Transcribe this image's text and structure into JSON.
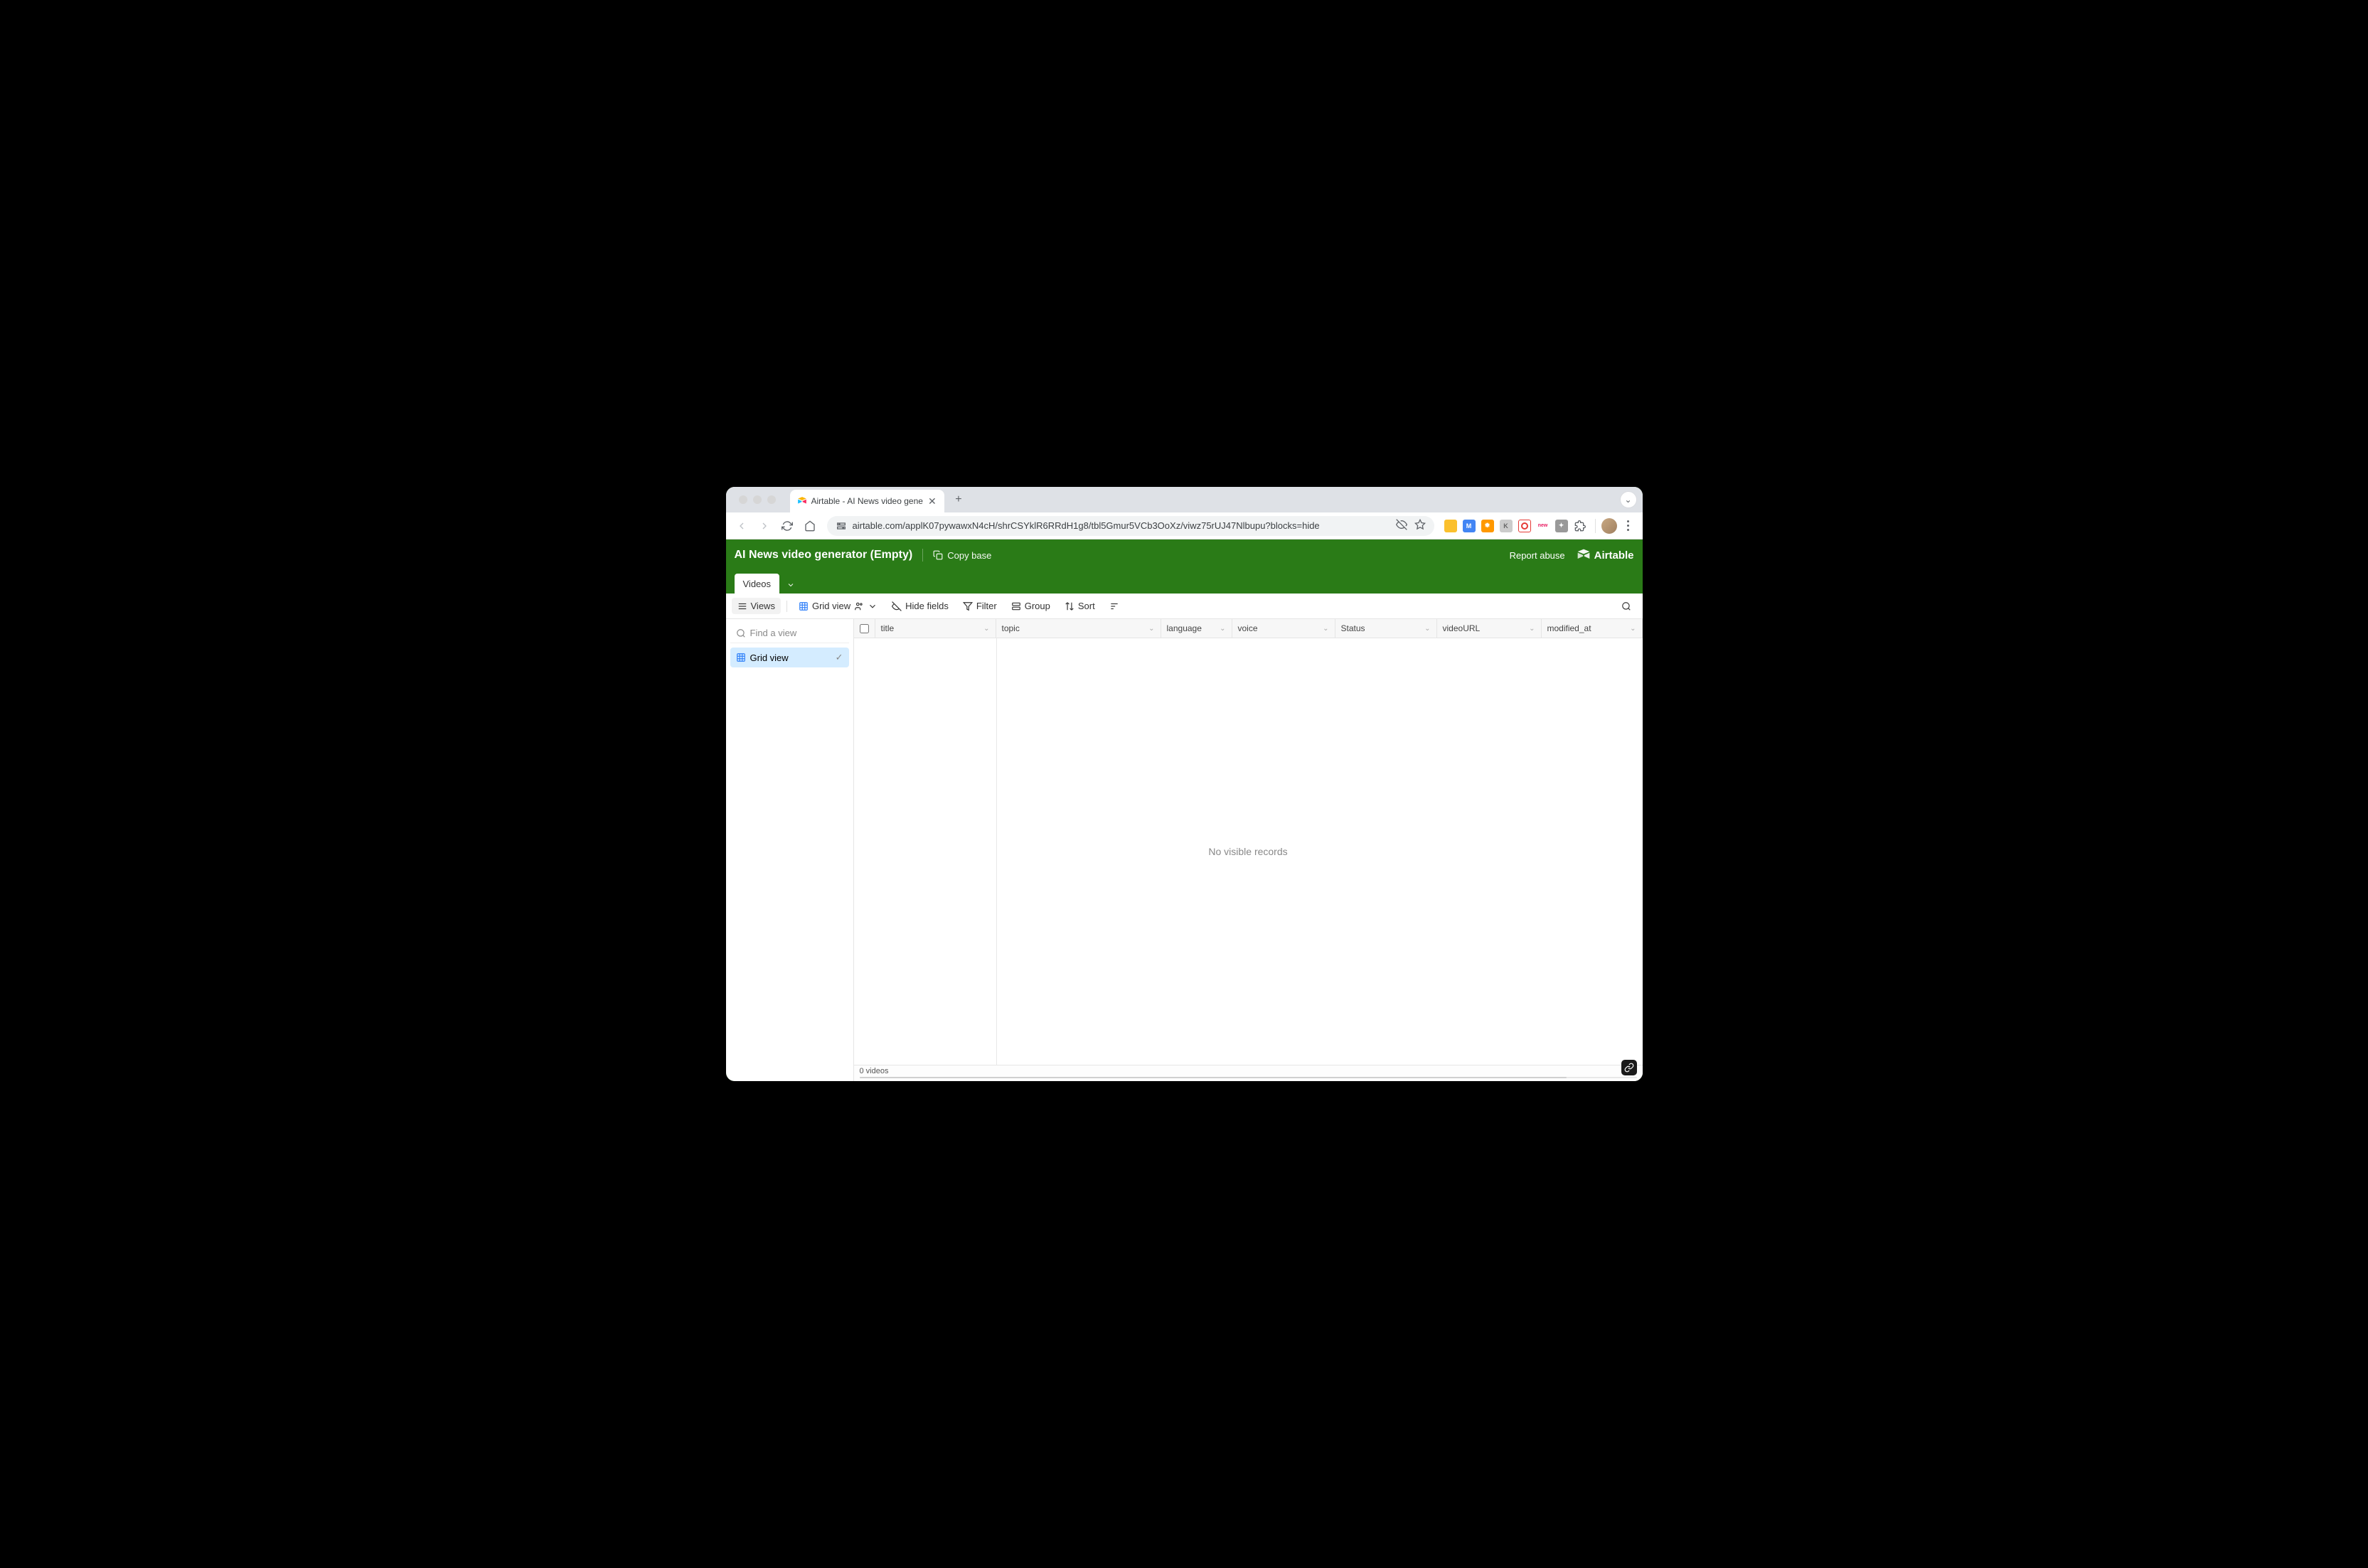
{
  "browser": {
    "tab_title": "Airtable - AI News video gene",
    "url": "airtable.com/applK07pywawxN4cH/shrCSYklR6RRdH1g8/tbl5Gmur5VCb3OoXz/viwz75rUJ47Nlbupu?blocks=hide"
  },
  "header": {
    "base_title": "AI News video generator (Empty)",
    "copy_base": "Copy base",
    "report_abuse": "Report abuse",
    "brand": "Airtable"
  },
  "tables": {
    "active": "Videos"
  },
  "toolbar": {
    "views": "Views",
    "grid_view": "Grid view",
    "hide_fields": "Hide fields",
    "filter": "Filter",
    "group": "Group",
    "sort": "Sort"
  },
  "sidebar": {
    "find_placeholder": "Find a view",
    "views": [
      {
        "label": "Grid view",
        "active": true
      }
    ]
  },
  "columns": [
    "title",
    "topic",
    "language",
    "voice",
    "Status",
    "videoURL",
    "modified_at"
  ],
  "grid": {
    "empty_message": "No visible records",
    "footer": "0 videos"
  }
}
